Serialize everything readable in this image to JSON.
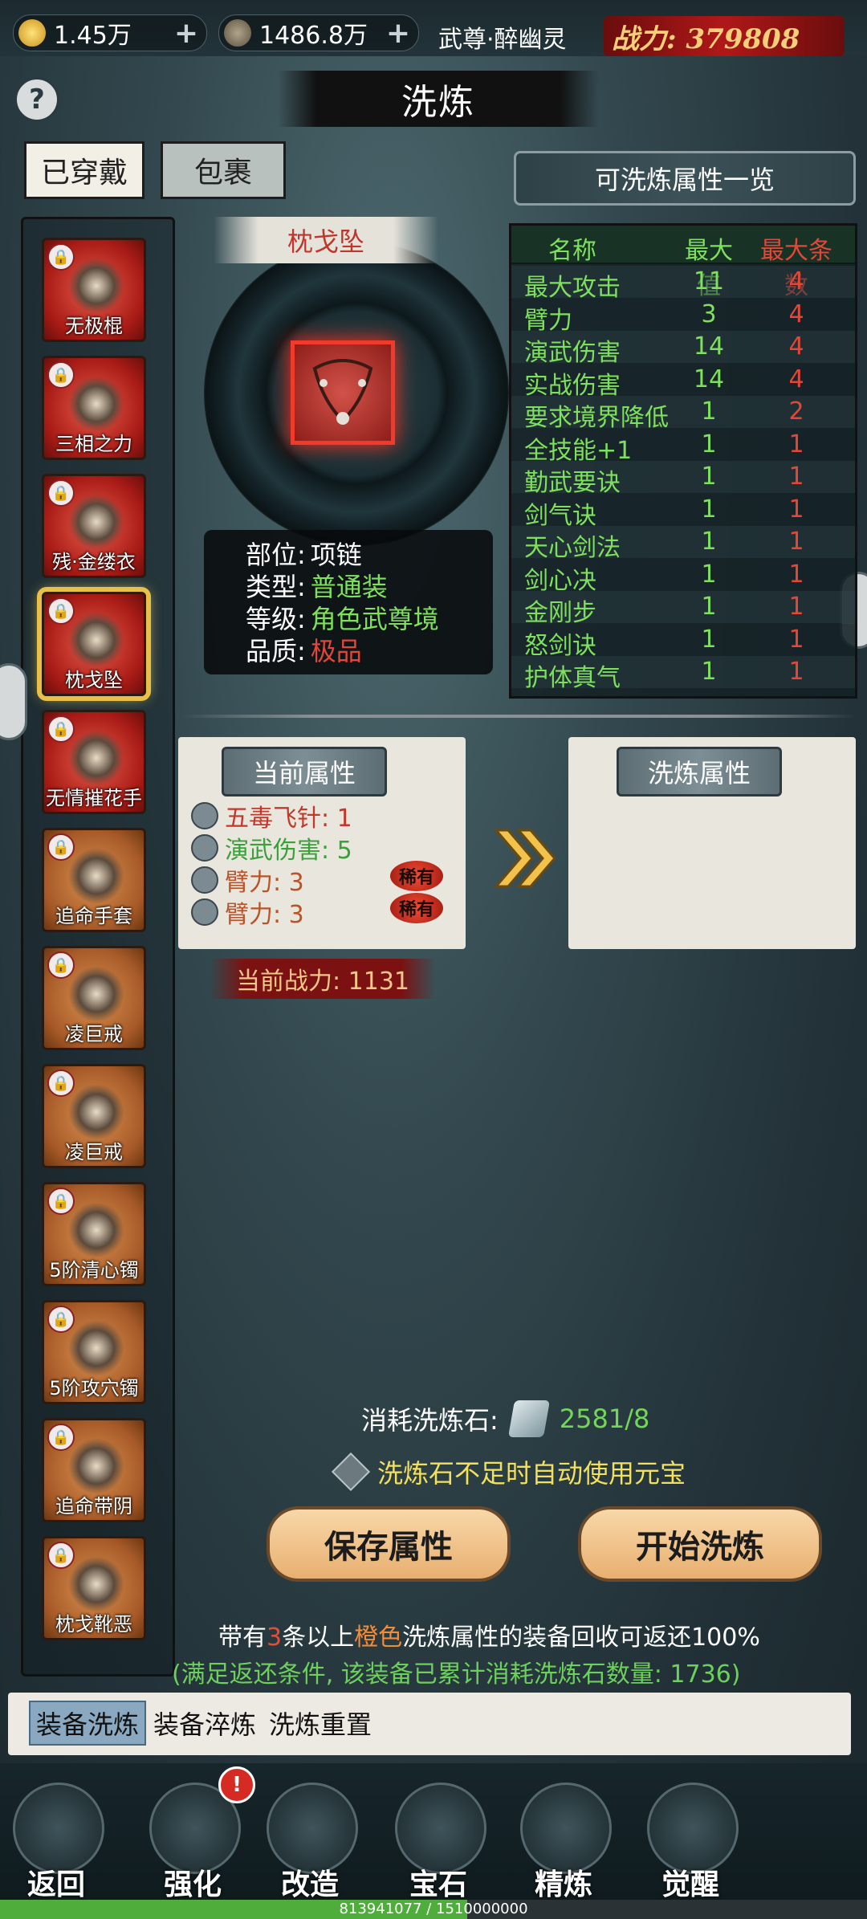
{
  "topbar": {
    "gold": "1.45万",
    "coins": "1486.8万",
    "nickname": "武尊·醉幽灵",
    "power": "战力: 379808"
  },
  "title": "洗炼",
  "help": "?",
  "tabs": [
    "已穿戴",
    "包裹"
  ],
  "equipment": [
    {
      "name": "无极棍",
      "rarity": "red"
    },
    {
      "name": "三相之力",
      "rarity": "red"
    },
    {
      "name": "残·金缕衣",
      "rarity": "red"
    },
    {
      "name": "枕戈坠",
      "rarity": "red",
      "selected": true
    },
    {
      "name": "无情摧花手",
      "rarity": "red"
    },
    {
      "name": "追命手套",
      "rarity": "orange"
    },
    {
      "name": "凌巨戒",
      "rarity": "orange"
    },
    {
      "name": "凌巨戒",
      "rarity": "orange"
    },
    {
      "name": "5阶清心镯",
      "rarity": "orange"
    },
    {
      "name": "5阶攻穴镯",
      "rarity": "orange"
    },
    {
      "name": "追命带阴",
      "rarity": "orange"
    },
    {
      "name": "枕戈靴恶",
      "rarity": "orange"
    }
  ],
  "item": {
    "name": "枕戈坠",
    "info": [
      {
        "label": "部位:",
        "value": "项链",
        "color": "#ffffff"
      },
      {
        "label": "类型:",
        "value": "普通装",
        "color": "#7fe05d"
      },
      {
        "label": "等级:",
        "value": "角色武尊境",
        "color": "#7fe05d"
      },
      {
        "label": "品质:",
        "value": "极品",
        "color": "#e24738"
      }
    ]
  },
  "attr_table": {
    "button": "可洗炼属性一览",
    "headers": [
      "名称",
      "最大值",
      "最大条数"
    ],
    "rows": [
      [
        "最大攻击",
        "11",
        "4"
      ],
      [
        "臂力",
        "3",
        "4"
      ],
      [
        "演武伤害",
        "14",
        "4"
      ],
      [
        "实战伤害",
        "14",
        "4"
      ],
      [
        "要求境界降低",
        "1",
        "2"
      ],
      [
        "全技能+1",
        "1",
        "1"
      ],
      [
        "勤武要诀",
        "1",
        "1"
      ],
      [
        "剑气诀",
        "1",
        "1"
      ],
      [
        "天心剑法",
        "1",
        "1"
      ],
      [
        "剑心决",
        "1",
        "1"
      ],
      [
        "金刚步",
        "1",
        "1"
      ],
      [
        "怒剑诀",
        "1",
        "1"
      ],
      [
        "护体真气",
        "1",
        "1"
      ]
    ]
  },
  "current": {
    "title": "当前属性",
    "attrs": [
      {
        "text": "五毒飞针: 1",
        "color": "#c0392b",
        "rare": ""
      },
      {
        "text": "演武伤害: 5",
        "color": "#3aa03a",
        "rare": ""
      },
      {
        "text": "臂力: 3",
        "color": "#b9542a",
        "rare": "稀有"
      },
      {
        "text": "臂力: 3",
        "color": "#b9542a",
        "rare": "稀有"
      }
    ],
    "power": "当前战力: 1131"
  },
  "refine": {
    "title": "洗炼属性"
  },
  "consume": {
    "label": "消耗洗炼石:",
    "value": "2581/8"
  },
  "auto_text": "洗炼石不足时自动使用元宝",
  "buttons": {
    "save": "保存属性",
    "start": "开始洗炼"
  },
  "note1": {
    "a": "带有",
    "b": "3",
    "c": "条以上",
    "d": "橙色",
    "e": "洗炼属性的装备回收可返还100%"
  },
  "note2": "(满足返还条件, 该装备已累计消耗洗炼石数量: 1736)",
  "subtabs": [
    "装备洗炼",
    "装备淬炼",
    "洗炼重置"
  ],
  "nav": [
    {
      "label": "返回",
      "icon": "return-icon"
    },
    {
      "label": "强化",
      "icon": "anvil-icon",
      "alert": "!"
    },
    {
      "label": "改造",
      "icon": "armor-icon"
    },
    {
      "label": "宝石",
      "icon": "gem-icon"
    },
    {
      "label": "精炼",
      "icon": "cauldron-icon"
    },
    {
      "label": "觉醒",
      "icon": "spirit-icon"
    }
  ],
  "xp": {
    "text": "813941077 / 1510000000",
    "fraction": 0.539
  }
}
